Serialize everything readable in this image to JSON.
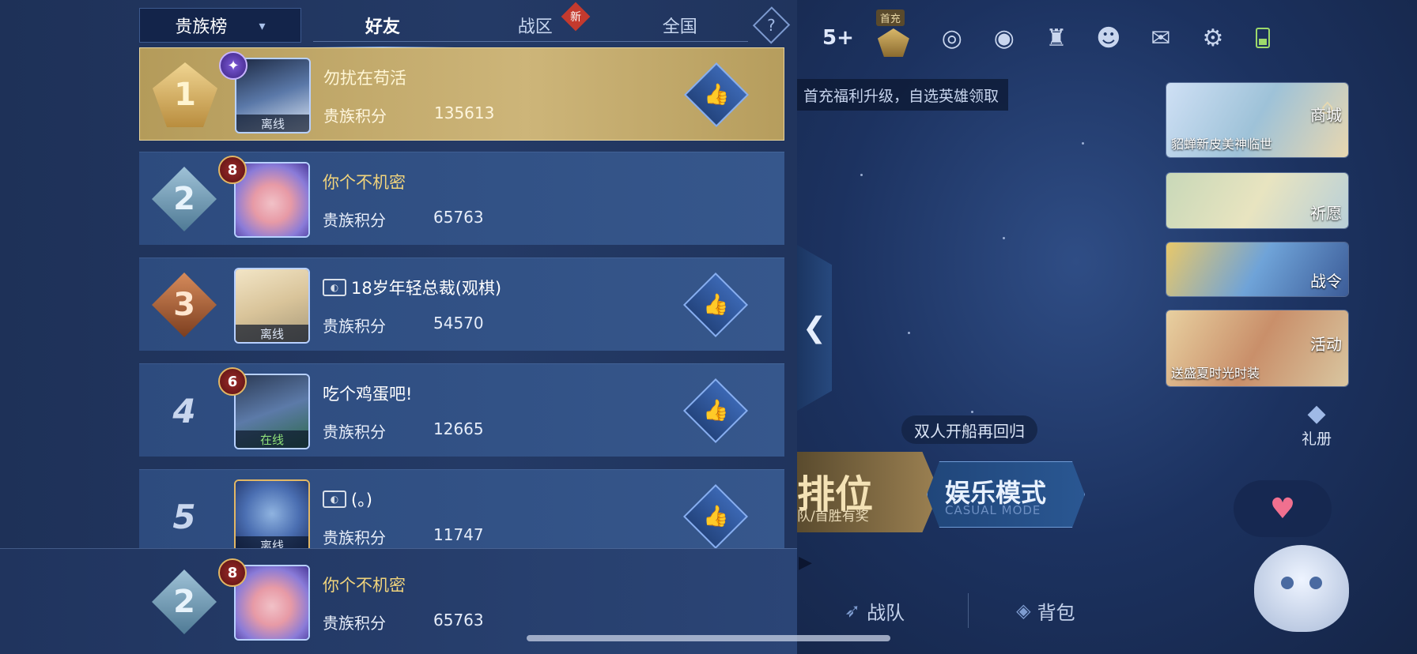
{
  "tabs": {
    "dropdown_label": "贵族榜",
    "friends": "好友",
    "zone": "战区",
    "zone_badge": "新",
    "national": "全国",
    "help": "?"
  },
  "leaderboard": [
    {
      "rank": "1",
      "name": "勿扰在苟活",
      "score_label": "贵族积分",
      "score": "135613",
      "status": "离线",
      "level": "",
      "has_like": true
    },
    {
      "rank": "2",
      "name": "你个不机密",
      "score_label": "贵族积分",
      "score": "65763",
      "status": "",
      "level": "8",
      "has_like": false
    },
    {
      "rank": "3",
      "name": "18岁年轻总裁(观棋)",
      "score_label": "贵族积分",
      "score": "54570",
      "status": "离线",
      "level": "",
      "has_like": true
    },
    {
      "rank": "4",
      "name": "吃个鸡蛋吧!",
      "score_label": "贵族积分",
      "score": "12665",
      "status": "在线",
      "level": "6",
      "has_like": true
    },
    {
      "rank": "5",
      "name": "(。)",
      "score_label": "贵族积分",
      "score": "11747",
      "status": "离线",
      "level": "",
      "has_like": true
    }
  ],
  "my_row": {
    "rank": "2",
    "name": "你个不机密",
    "score_label": "贵族积分",
    "score": "65763",
    "level": "8"
  },
  "top_bar": {
    "count": "5",
    "first_charge": "首充"
  },
  "promo_banner": "首充福利升级，自选英雄领取",
  "side_cards": {
    "shop_sub": "貂蝉新皮美神临世",
    "shop_label": "商城",
    "wish_label": "祈愿",
    "pass_label": "战令",
    "event_sub": "送盛夏时光时装",
    "event_label": "活动"
  },
  "gift_label": "礼册",
  "duo_tag": "双人开船再回归",
  "ranked": {
    "big": "排位",
    "small": "队/首胜有奖"
  },
  "casual": {
    "big": "娱乐模式",
    "small": "CASUAL MODE"
  },
  "bottom_tabs": {
    "team": "战队",
    "bag": "背包"
  },
  "colors": {
    "gold_row": "#cdb579",
    "panel": "#243a66",
    "accent": "#87aef0"
  }
}
